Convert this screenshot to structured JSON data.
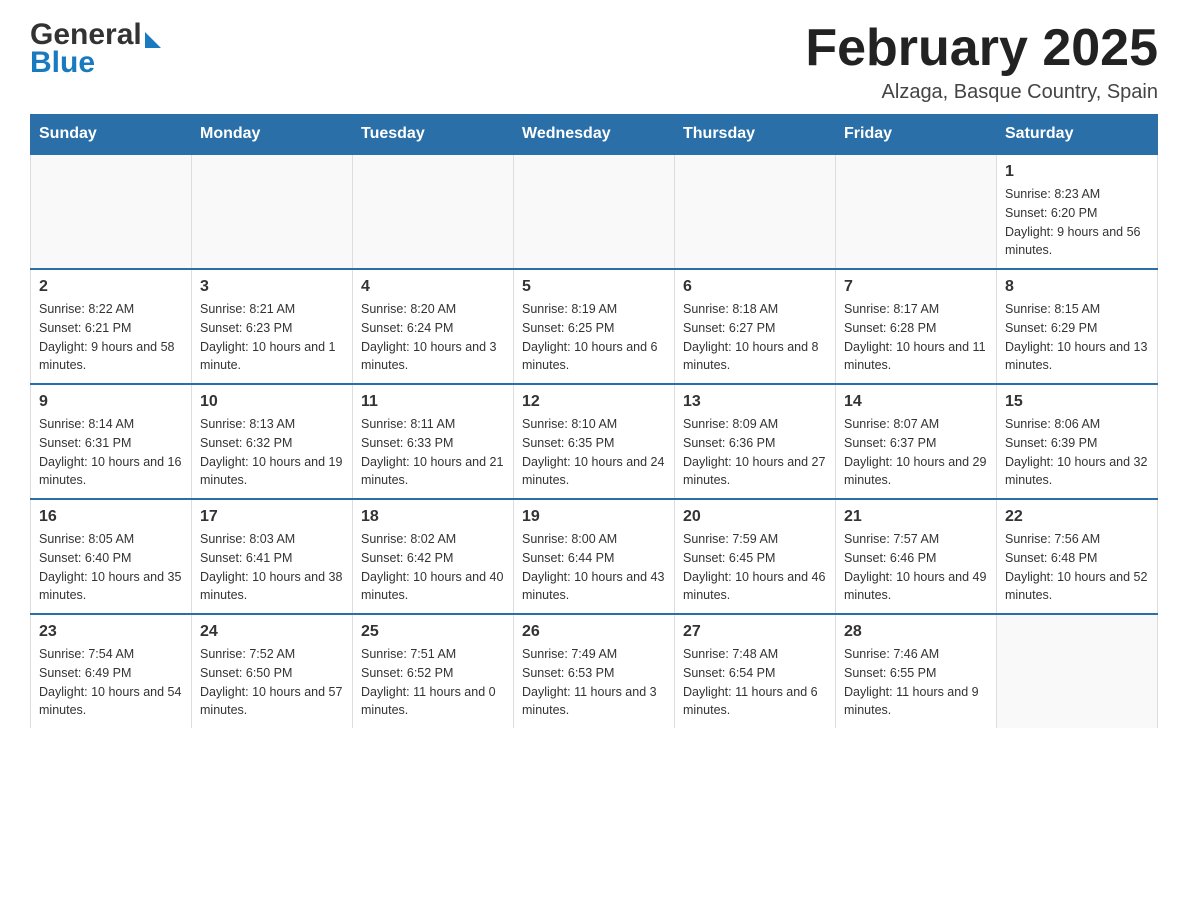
{
  "header": {
    "month_title": "February 2025",
    "location": "Alzaga, Basque Country, Spain",
    "logo_general": "General",
    "logo_blue": "Blue"
  },
  "weekdays": [
    "Sunday",
    "Monday",
    "Tuesday",
    "Wednesday",
    "Thursday",
    "Friday",
    "Saturday"
  ],
  "weeks": [
    [
      {
        "day": "",
        "info": ""
      },
      {
        "day": "",
        "info": ""
      },
      {
        "day": "",
        "info": ""
      },
      {
        "day": "",
        "info": ""
      },
      {
        "day": "",
        "info": ""
      },
      {
        "day": "",
        "info": ""
      },
      {
        "day": "1",
        "info": "Sunrise: 8:23 AM\nSunset: 6:20 PM\nDaylight: 9 hours and 56 minutes."
      }
    ],
    [
      {
        "day": "2",
        "info": "Sunrise: 8:22 AM\nSunset: 6:21 PM\nDaylight: 9 hours and 58 minutes."
      },
      {
        "day": "3",
        "info": "Sunrise: 8:21 AM\nSunset: 6:23 PM\nDaylight: 10 hours and 1 minute."
      },
      {
        "day": "4",
        "info": "Sunrise: 8:20 AM\nSunset: 6:24 PM\nDaylight: 10 hours and 3 minutes."
      },
      {
        "day": "5",
        "info": "Sunrise: 8:19 AM\nSunset: 6:25 PM\nDaylight: 10 hours and 6 minutes."
      },
      {
        "day": "6",
        "info": "Sunrise: 8:18 AM\nSunset: 6:27 PM\nDaylight: 10 hours and 8 minutes."
      },
      {
        "day": "7",
        "info": "Sunrise: 8:17 AM\nSunset: 6:28 PM\nDaylight: 10 hours and 11 minutes."
      },
      {
        "day": "8",
        "info": "Sunrise: 8:15 AM\nSunset: 6:29 PM\nDaylight: 10 hours and 13 minutes."
      }
    ],
    [
      {
        "day": "9",
        "info": "Sunrise: 8:14 AM\nSunset: 6:31 PM\nDaylight: 10 hours and 16 minutes."
      },
      {
        "day": "10",
        "info": "Sunrise: 8:13 AM\nSunset: 6:32 PM\nDaylight: 10 hours and 19 minutes."
      },
      {
        "day": "11",
        "info": "Sunrise: 8:11 AM\nSunset: 6:33 PM\nDaylight: 10 hours and 21 minutes."
      },
      {
        "day": "12",
        "info": "Sunrise: 8:10 AM\nSunset: 6:35 PM\nDaylight: 10 hours and 24 minutes."
      },
      {
        "day": "13",
        "info": "Sunrise: 8:09 AM\nSunset: 6:36 PM\nDaylight: 10 hours and 27 minutes."
      },
      {
        "day": "14",
        "info": "Sunrise: 8:07 AM\nSunset: 6:37 PM\nDaylight: 10 hours and 29 minutes."
      },
      {
        "day": "15",
        "info": "Sunrise: 8:06 AM\nSunset: 6:39 PM\nDaylight: 10 hours and 32 minutes."
      }
    ],
    [
      {
        "day": "16",
        "info": "Sunrise: 8:05 AM\nSunset: 6:40 PM\nDaylight: 10 hours and 35 minutes."
      },
      {
        "day": "17",
        "info": "Sunrise: 8:03 AM\nSunset: 6:41 PM\nDaylight: 10 hours and 38 minutes."
      },
      {
        "day": "18",
        "info": "Sunrise: 8:02 AM\nSunset: 6:42 PM\nDaylight: 10 hours and 40 minutes."
      },
      {
        "day": "19",
        "info": "Sunrise: 8:00 AM\nSunset: 6:44 PM\nDaylight: 10 hours and 43 minutes."
      },
      {
        "day": "20",
        "info": "Sunrise: 7:59 AM\nSunset: 6:45 PM\nDaylight: 10 hours and 46 minutes."
      },
      {
        "day": "21",
        "info": "Sunrise: 7:57 AM\nSunset: 6:46 PM\nDaylight: 10 hours and 49 minutes."
      },
      {
        "day": "22",
        "info": "Sunrise: 7:56 AM\nSunset: 6:48 PM\nDaylight: 10 hours and 52 minutes."
      }
    ],
    [
      {
        "day": "23",
        "info": "Sunrise: 7:54 AM\nSunset: 6:49 PM\nDaylight: 10 hours and 54 minutes."
      },
      {
        "day": "24",
        "info": "Sunrise: 7:52 AM\nSunset: 6:50 PM\nDaylight: 10 hours and 57 minutes."
      },
      {
        "day": "25",
        "info": "Sunrise: 7:51 AM\nSunset: 6:52 PM\nDaylight: 11 hours and 0 minutes."
      },
      {
        "day": "26",
        "info": "Sunrise: 7:49 AM\nSunset: 6:53 PM\nDaylight: 11 hours and 3 minutes."
      },
      {
        "day": "27",
        "info": "Sunrise: 7:48 AM\nSunset: 6:54 PM\nDaylight: 11 hours and 6 minutes."
      },
      {
        "day": "28",
        "info": "Sunrise: 7:46 AM\nSunset: 6:55 PM\nDaylight: 11 hours and 9 minutes."
      },
      {
        "day": "",
        "info": ""
      }
    ]
  ]
}
